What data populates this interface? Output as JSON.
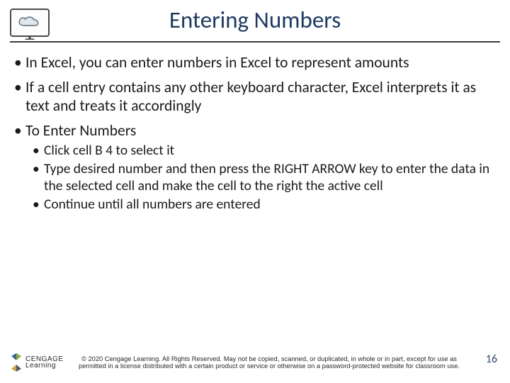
{
  "title": "Entering Numbers",
  "bullets": {
    "b1": "In Excel, you can enter numbers in Excel to represent amounts",
    "b2": "If a cell entry contains any other keyboard character, Excel interprets it as text and treats it accordingly",
    "b3": "To Enter Numbers",
    "sub": {
      "s1": "Click cell B 4 to select it",
      "s2": "Type desired number and then press the RIGHT ARROW key to enter the data in the selected cell and make the cell to the right the active cell",
      "s3": "Continue until all numbers are entered"
    }
  },
  "footer": {
    "logo_line1": "CENGAGE",
    "logo_line2": "Learning",
    "copyright": "© 2020 Cengage Learning. All Rights Reserved. May not be copied, scanned, or duplicated, in whole or in part, except for use as permitted in a license distributed with a certain product or service or otherwise on a password-protected website for classroom use.",
    "page_number": "16"
  },
  "icons": {
    "header": "cloud-monitor-icon"
  }
}
